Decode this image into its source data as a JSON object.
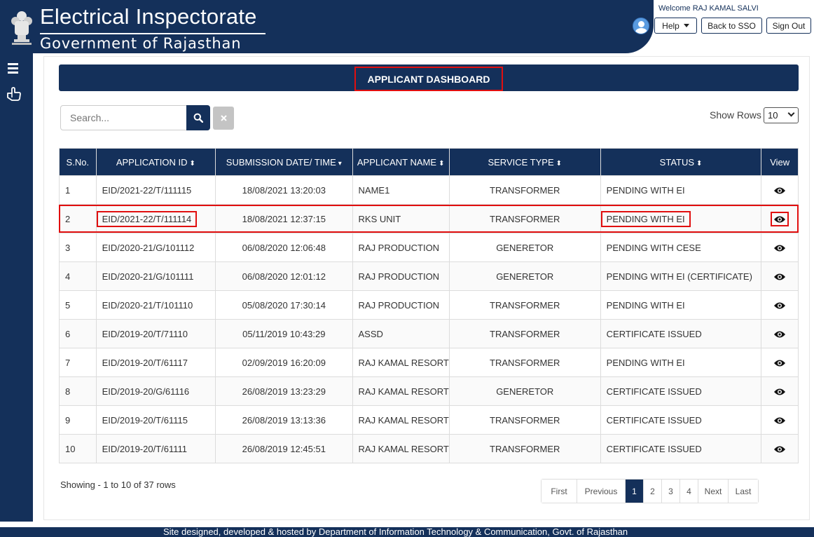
{
  "header": {
    "title": "Electrical Inspectorate",
    "subtitle": "Government of Rajasthan",
    "welcome": "Welcome RAJ KAMAL SALVI",
    "help_label": "Help",
    "back_label": "Back to SSO",
    "signout_label": "Sign Out"
  },
  "dashboard": {
    "title": "APPLICANT DASHBOARD"
  },
  "search": {
    "placeholder": "Search...",
    "show_rows_label": "Show Rows",
    "rows_value": "10"
  },
  "table": {
    "headers": [
      "S.No.",
      "APPLICATION ID",
      "SUBMISSION DATE/ TIME",
      "APPLICANT NAME",
      "SERVICE TYPE",
      "STATUS",
      "View"
    ],
    "rows": [
      {
        "sno": "1",
        "id": "EID/2021-22/T/111115",
        "date": "18/08/2021 13:20:03",
        "name": "NAME1",
        "type": "TRANSFORMER",
        "status": "PENDING WITH EI"
      },
      {
        "sno": "2",
        "id": "EID/2021-22/T/111114",
        "date": "18/08/2021 12:37:15",
        "name": "RKS UNIT",
        "type": "TRANSFORMER",
        "status": "PENDING WITH EI"
      },
      {
        "sno": "3",
        "id": "EID/2020-21/G/101112",
        "date": "06/08/2020 12:06:48",
        "name": "RAJ PRODUCTION",
        "type": "GENERETOR",
        "status": "PENDING WITH CESE"
      },
      {
        "sno": "4",
        "id": "EID/2020-21/G/101111",
        "date": "06/08/2020 12:01:12",
        "name": "RAJ PRODUCTION",
        "type": "GENERETOR",
        "status": "PENDING WITH EI (CERTIFICATE)"
      },
      {
        "sno": "5",
        "id": "EID/2020-21/T/101110",
        "date": "05/08/2020 17:30:14",
        "name": "RAJ PRODUCTION",
        "type": "TRANSFORMER",
        "status": "PENDING WITH EI"
      },
      {
        "sno": "6",
        "id": "EID/2019-20/T/71110",
        "date": "05/11/2019 10:43:29",
        "name": "ASSD",
        "type": "TRANSFORMER",
        "status": "CERTIFICATE ISSUED"
      },
      {
        "sno": "7",
        "id": "EID/2019-20/T/61117",
        "date": "02/09/2019 16:20:09",
        "name": "RAJ KAMAL RESORT",
        "type": "TRANSFORMER",
        "status": "PENDING WITH EI"
      },
      {
        "sno": "8",
        "id": "EID/2019-20/G/61116",
        "date": "26/08/2019 13:23:29",
        "name": "RAJ KAMAL RESORT",
        "type": "GENERETOR",
        "status": "CERTIFICATE ISSUED"
      },
      {
        "sno": "9",
        "id": "EID/2019-20/T/61115",
        "date": "26/08/2019 13:13:36",
        "name": "RAJ KAMAL RESORT",
        "type": "TRANSFORMER",
        "status": "CERTIFICATE ISSUED"
      },
      {
        "sno": "10",
        "id": "EID/2019-20/T/61111",
        "date": "26/08/2019 12:45:51",
        "name": "RAJ KAMAL RESORT",
        "type": "TRANSFORMER",
        "status": "CERTIFICATE ISSUED"
      }
    ]
  },
  "pagination": {
    "showing": "Showing - 1 to 10 of 37 rows",
    "first": "First",
    "previous": "Previous",
    "pages": [
      "1",
      "2",
      "3",
      "4"
    ],
    "active_page": "1",
    "next": "Next",
    "last": "Last"
  },
  "footer": {
    "text": "Site designed, developed & hosted by Department of Information Technology & Communication, Govt. of Rajasthan"
  },
  "colors": {
    "brand": "#14305a",
    "highlight": "#e10f0f"
  },
  "icons": [
    "state-emblem-icon",
    "user-avatar-icon",
    "hamburger-menu-icon",
    "hand-pointer-icon",
    "search-icon",
    "close-icon",
    "sort-icon",
    "eye-icon"
  ]
}
